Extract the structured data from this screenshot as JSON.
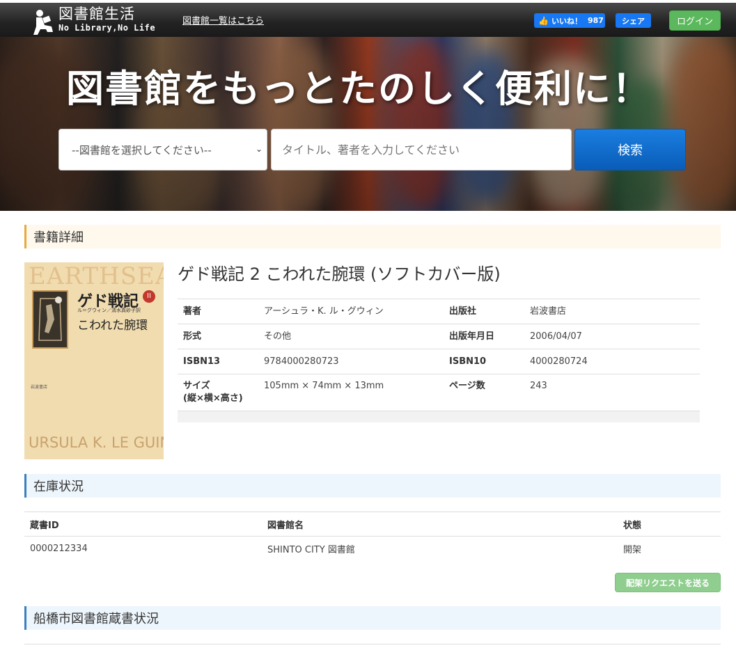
{
  "header": {
    "logo_title": "図書館生活",
    "logo_subtitle": "No Library,No Life",
    "library_list_link": "図書館一覧はこちら",
    "like_label": "いいね！",
    "like_count": "987",
    "share_label": "シェア",
    "login_label": "ログイン",
    "brand_color": "#1877f2",
    "login_color": "#5cb85c"
  },
  "hero": {
    "title": "図書館をもっとたのしく便利に！",
    "library_select_value": "--図書館を選択してください--",
    "search_placeholder": "タイトル、著者を入力してください",
    "search_button": "検索"
  },
  "book_detail": {
    "section_title": "書籍詳細",
    "title": "ゲド戦記 2 こわれた腕環 (ソフトカバー版)",
    "cover": {
      "series_text": "EARTHSEA",
      "jp_title": "ゲド戦記",
      "volume": "II",
      "credits": "ル＝グウィン／清水真砂子訳",
      "subtitle": "こわれた腕環",
      "publisher": "岩波書店",
      "author": "URSULA K. LE GUIN"
    },
    "rows": [
      {
        "label1": "著者",
        "value1": "アーシュラ・K. ル・グウィン",
        "label2": "出版社",
        "value2": "岩波書店"
      },
      {
        "label1": "形式",
        "value1": "その他",
        "label2": "出版年月日",
        "value2": "2006/04/07"
      },
      {
        "label1": "ISBN13",
        "value1": "9784000280723",
        "label2": "ISBN10",
        "value2": "4000280724"
      },
      {
        "label1": "サイズ",
        "label1b": "(縦×横×高さ)",
        "value1": "105mm × 74mm × 13mm",
        "label2": "ページ数",
        "value2": "243"
      }
    ]
  },
  "stock": {
    "section_title": "在庫状況",
    "columns": [
      "蔵書ID",
      "図書館名",
      "状態"
    ],
    "rows": [
      {
        "id": "0000212334",
        "library": "SHINTO CITY 図書館",
        "status": "開架"
      }
    ],
    "request_button": "配架リクエストを送る"
  },
  "funabashi": {
    "section_title": "船橋市図書館蔵書状況"
  }
}
